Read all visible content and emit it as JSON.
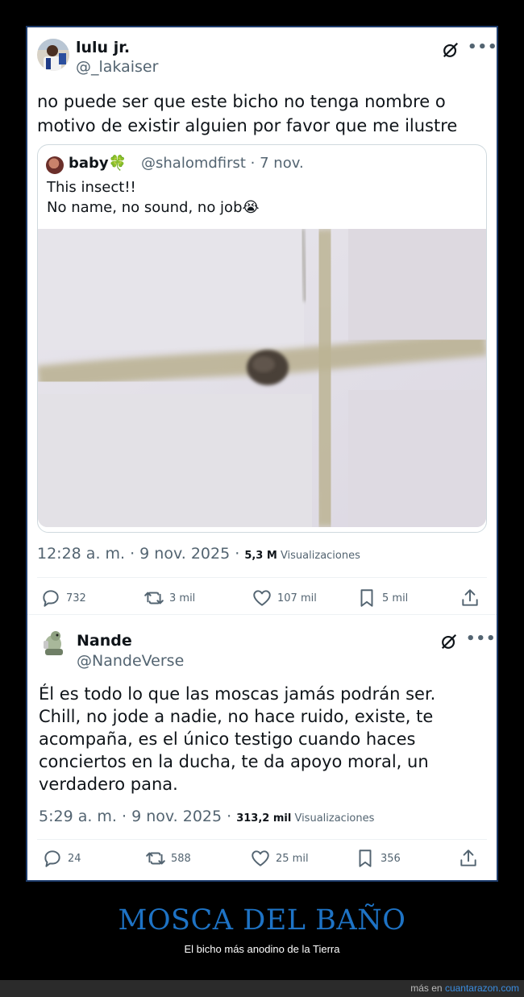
{
  "tweet1": {
    "name": "lulu jr.",
    "handle": "@_lakaiser",
    "text_line1": "no puede ser que este bicho no tenga nombre o",
    "text_line2": "motivo de existir alguien por favor que me ilustre",
    "quote": {
      "name": "baby🍀",
      "handle": "@shalomdfirst · 7 nov.",
      "line1": "This insect!!",
      "line2": "No name, no sound, no job😭"
    },
    "time": "12:28 a. m. · 9 nov. 2025 · ",
    "views_count": "5,3 M",
    "views_label": " Visualizaciones",
    "actions": {
      "replies": "732",
      "reposts": "3 mil",
      "likes": "107 mil",
      "bookmarks": "5 mil"
    }
  },
  "tweet2": {
    "name": "Nande",
    "handle": "@NandeVerse",
    "lines": [
      "Él es todo lo que las moscas jamás podrán ser.",
      "Chill, no jode a nadie, no hace ruido, existe, te",
      "acompaña, es el único testigo cuando haces",
      "conciertos en la ducha, te da apoyo moral, un",
      "verdadero pana."
    ],
    "time": "5:29 a. m. · 9 nov. 2025 · ",
    "views_count": "313,2 mil",
    "views_label": " Visualizaciones",
    "actions": {
      "replies": "24",
      "reposts": "588",
      "likes": "25 mil",
      "bookmarks": "356"
    }
  },
  "caption": {
    "title": "MOSCA DEL BAÑO",
    "subtitle": "El bicho más anodino de la Tierra"
  },
  "footer": {
    "prefix": "más en ",
    "link": "cuantarazon.com"
  },
  "colors": {
    "accent": "#1e73c5",
    "frame_border": "#1d3b6b",
    "muted_text": "#536471"
  }
}
